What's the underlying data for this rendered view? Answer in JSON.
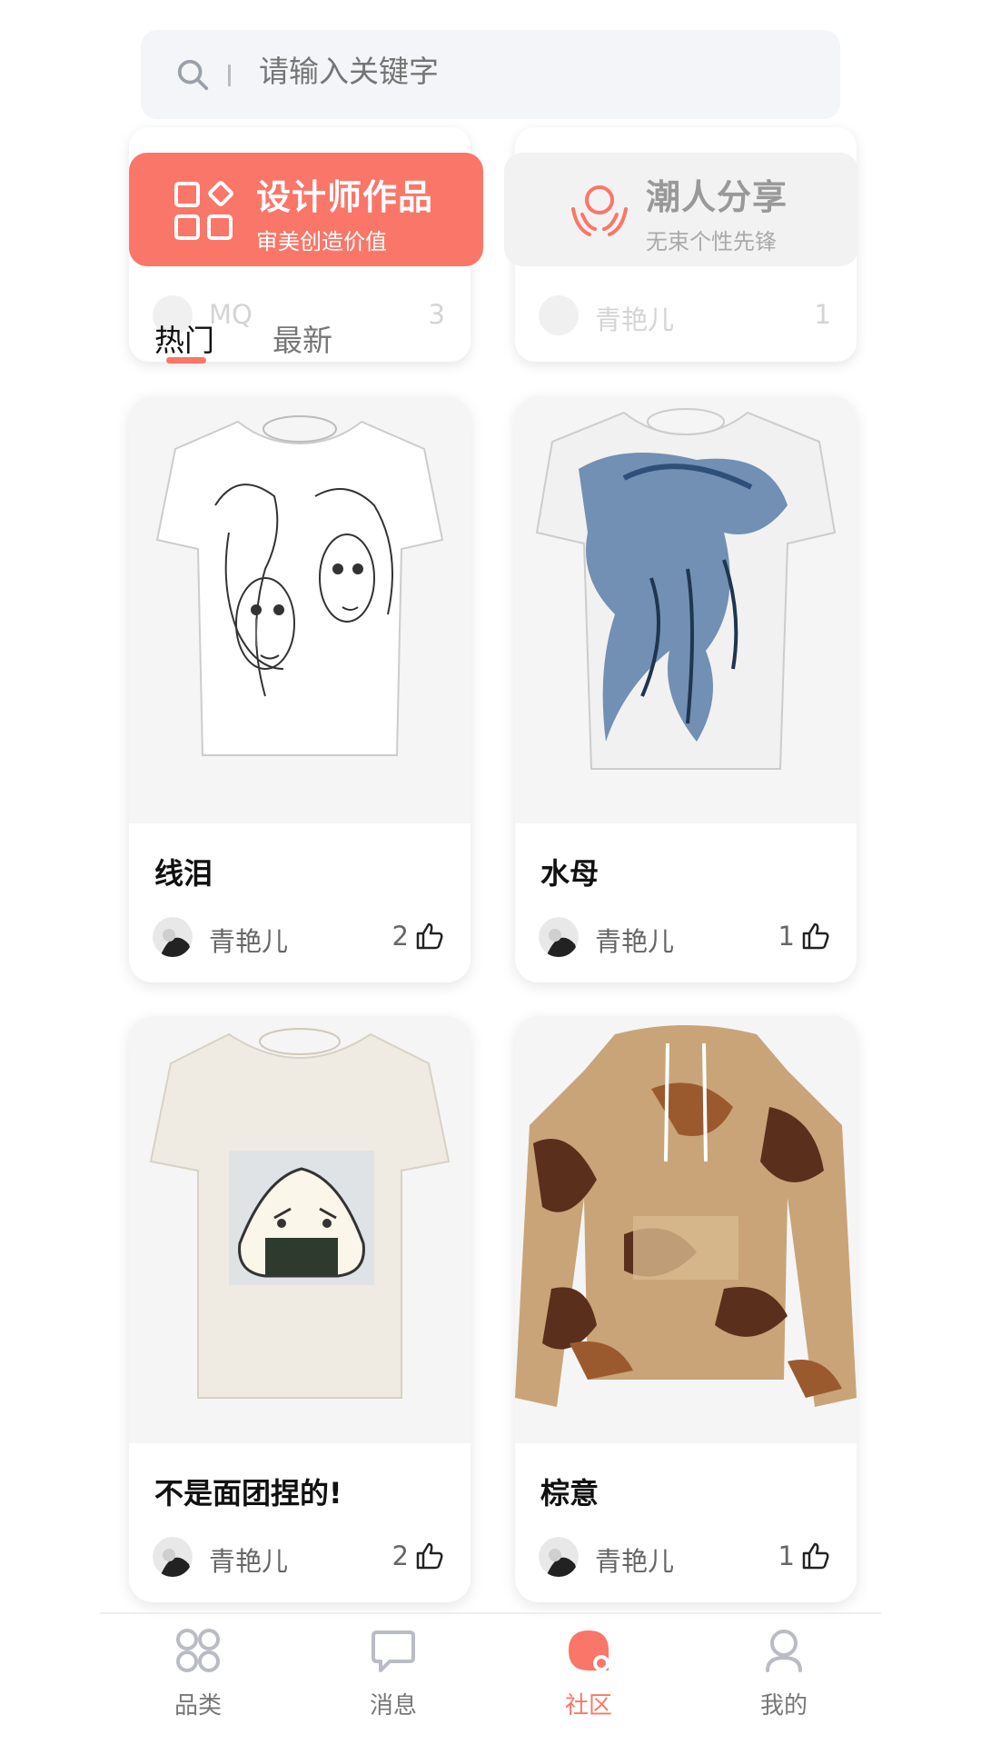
{
  "search": {
    "placeholder": "请输入关键字"
  },
  "features": [
    {
      "title": "设计师作品",
      "subtitle": "审美创造价值"
    },
    {
      "title": "潮人分享",
      "subtitle": "无束个性先锋"
    }
  ],
  "ghost_cards": [
    {
      "user": "MQ",
      "likes": "3"
    },
    {
      "user": "青艳儿",
      "likes": "1"
    }
  ],
  "tabs": [
    {
      "label": "热门"
    },
    {
      "label": "最新"
    }
  ],
  "products": [
    {
      "title": "线泪",
      "user": "青艳儿",
      "likes": "2"
    },
    {
      "title": "水母",
      "user": "青艳儿",
      "likes": "1"
    },
    {
      "title": "不是面团捏的!",
      "user": "青艳儿",
      "likes": "2"
    },
    {
      "title": "棕意",
      "user": "青艳儿",
      "likes": "1"
    }
  ],
  "nav": [
    {
      "label": "品类",
      "icon": "grid-icon"
    },
    {
      "label": "消息",
      "icon": "chat-icon"
    },
    {
      "label": "社区",
      "icon": "community-icon"
    },
    {
      "label": "我的",
      "icon": "profile-icon"
    }
  ],
  "colors": {
    "accent": "#fa7668",
    "search_bg": "#f4f5f8"
  }
}
